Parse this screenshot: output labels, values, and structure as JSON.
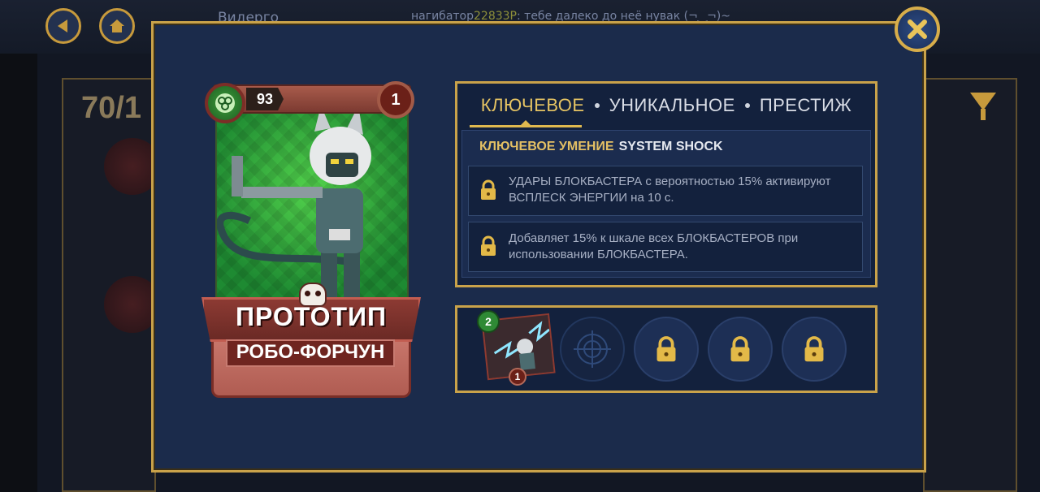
{
  "background": {
    "chat_user": "Видерго",
    "chat_sender": "нагибатор",
    "chat_sender_number": "22833Р",
    "chat_message": ": тебе далеко до неё нувак (¬‿¬)~",
    "counter": "70/1"
  },
  "card": {
    "rating": "93",
    "copies": "1",
    "name_line1": "ПРОТОТИП",
    "name_line2": "РОБО-ФОРЧУН"
  },
  "skills": {
    "tabs": [
      "КЛЮЧЕВОЕ",
      "УНИКАЛЬНОЕ",
      "ПРЕСТИЖ"
    ],
    "active_tab": "КЛЮЧЕВОЕ",
    "heading_label": "КЛЮЧЕВОЕ УМЕНИЕ",
    "heading_name": "SYSTEM SHOCK",
    "items": [
      "УДАРЫ БЛОКБАСТЕРА с вероятностью 15% активируют ВСПЛЕСК ЭНЕРГИИ на 10 с.",
      "Добавляет 15% к шкале всех БЛОКБАСТЕРОВ при использовании БЛОКБАСТЕРА."
    ]
  },
  "slots": {
    "move_level": "2",
    "move_count": "1"
  },
  "colors": {
    "gold": "#c9a24a",
    "panel": "#1b2b4b",
    "accent_text": "#e4c064",
    "card_green": "#3fbf45",
    "card_red": "#8c3a33"
  }
}
